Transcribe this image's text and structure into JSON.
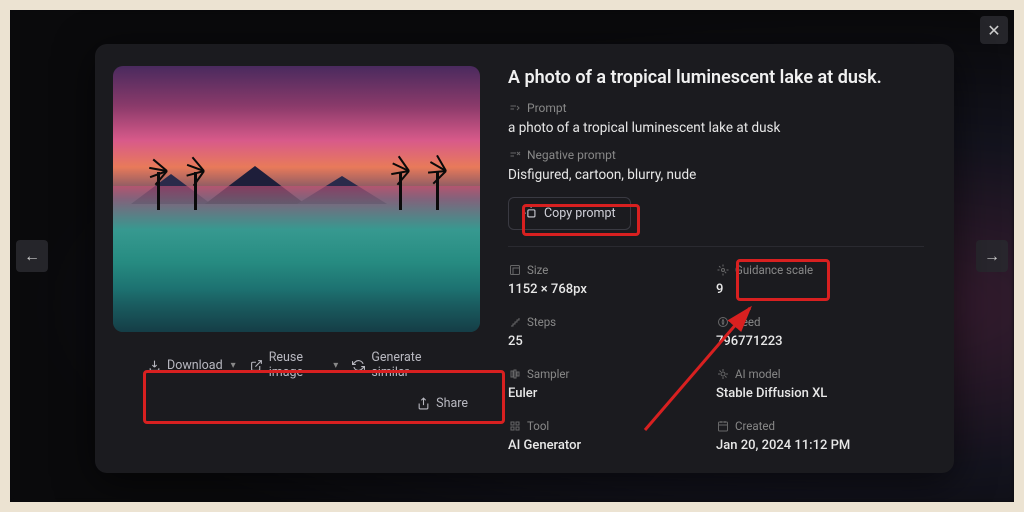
{
  "title": "A photo of a tropical luminescent lake at dusk.",
  "prompt": {
    "label": "Prompt",
    "value": "a photo of a tropical luminescent lake at dusk"
  },
  "negative_prompt": {
    "label": "Negative prompt",
    "value": "Disfigured, cartoon, blurry, nude"
  },
  "copy_button": "Copy prompt",
  "actions": {
    "download": "Download",
    "reuse": "Reuse image",
    "generate": "Generate similar",
    "share": "Share"
  },
  "meta": {
    "size": {
      "label": "Size",
      "value": "1152 × 768px"
    },
    "guidance": {
      "label": "Guidance scale",
      "value": "9"
    },
    "steps": {
      "label": "Steps",
      "value": "25"
    },
    "seed": {
      "label": "Seed",
      "value": "796771223"
    },
    "sampler": {
      "label": "Sampler",
      "value": "Euler"
    },
    "model": {
      "label": "AI model",
      "value": "Stable Diffusion XL"
    },
    "tool": {
      "label": "Tool",
      "value": "AI Generator"
    },
    "created": {
      "label": "Created",
      "value": "Jan 20, 2024 11:12 PM"
    }
  }
}
